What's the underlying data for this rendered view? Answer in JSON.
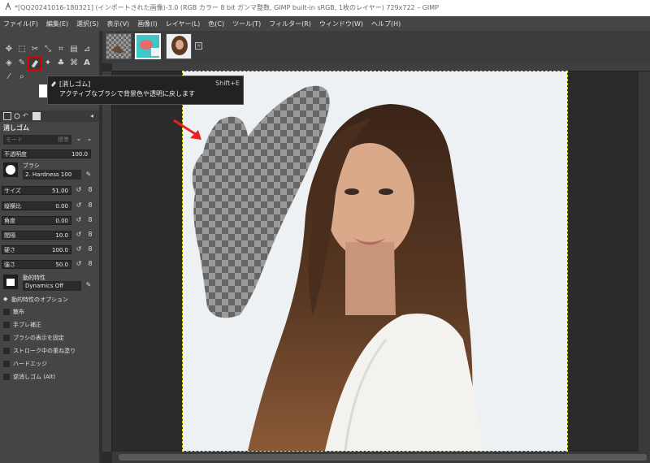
{
  "window": {
    "title": "*[QQ20241016-180321] (インポートされた画像)-3.0 (RGB カラー 8 bit ガンマ整数, GIMP built-in sRGB, 1枚のレイヤー) 729x722 – GIMP"
  },
  "menu": [
    "ファイル(F)",
    "編集(E)",
    "選択(S)",
    "表示(V)",
    "画像(I)",
    "レイヤー(L)",
    "色(C)",
    "ツール(T)",
    "フィルター(R)",
    "ウィンドウ(W)",
    "ヘルプ(H)"
  ],
  "tooltip": {
    "title": "[消しゴム]",
    "description": "アクティブなブラシで背景色や透明に戻します",
    "shortcut": "Shift+E"
  },
  "tool_options": {
    "title": "消しゴム",
    "mode_label": "モード",
    "mode_value": "標準",
    "opacity_label": "不透明度",
    "opacity_value": "100.0",
    "brush_label": "ブラシ",
    "brush_value": "2. Hardness 100",
    "size_label": "サイズ",
    "size_value": "51.00",
    "aspect_label": "縦横比",
    "aspect_value": "0.00",
    "angle_label": "角度",
    "angle_value": "0.00",
    "spacing_label": "間隔",
    "spacing_value": "10.0",
    "hardness_label": "硬さ",
    "hardness_value": "100.0",
    "force_label": "強さ",
    "force_value": "50.0",
    "dynamics_label": "動的特性",
    "dynamics_value": "Dynamics Off",
    "dynamics_options_label": "動的特性のオプション",
    "checkboxes": [
      "散布",
      "手ブレ補正",
      "ブラシの表示を固定",
      "ストローク中の重ね塗り",
      "ハードエッジ",
      "逆消しゴム (Alt)"
    ]
  },
  "colors": {
    "highlight": "#e00000",
    "arrow": "#e8231d",
    "selection_outline": "#e8e800"
  },
  "icons": [
    "move-icon",
    "crop-icon",
    "paintbrush-icon",
    "eraser-icon",
    "text-icon",
    "zoom-icon",
    "close-icon"
  ]
}
